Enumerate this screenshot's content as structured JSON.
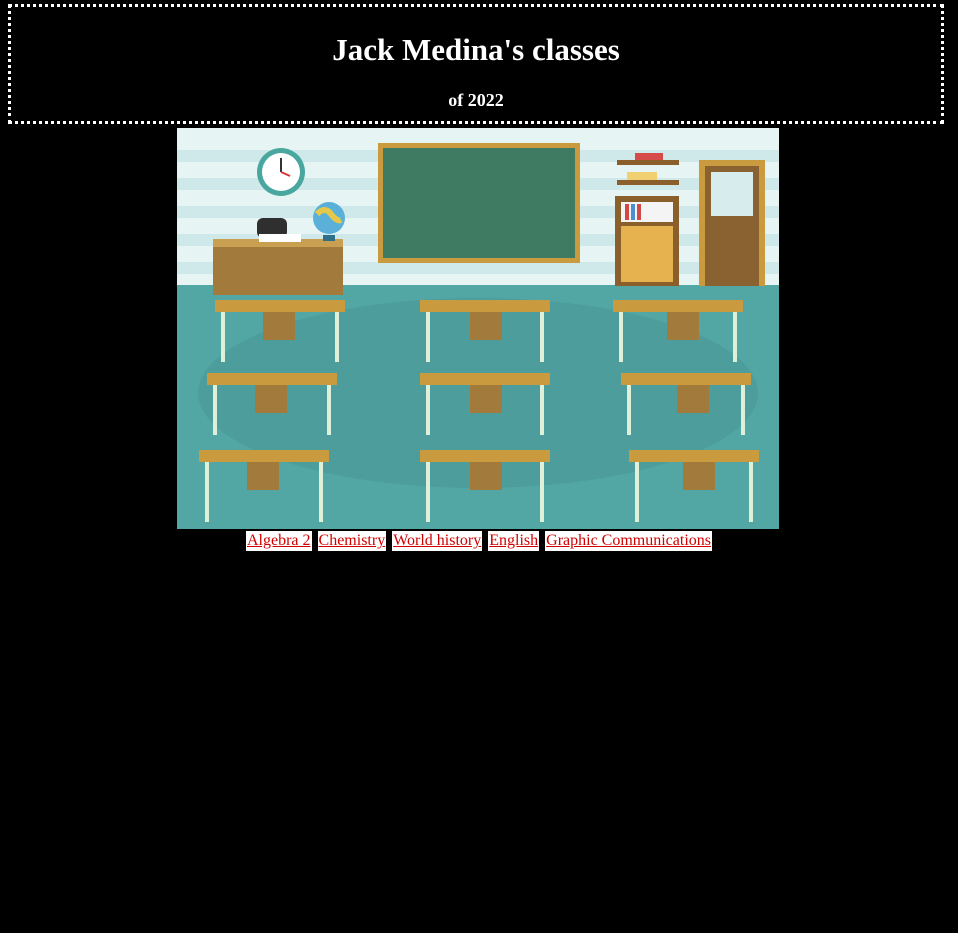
{
  "header": {
    "title": "Jack Medina's classes",
    "subtitle": "of 2022"
  },
  "hero": {
    "alt": "classroom illustration"
  },
  "nav": {
    "links": [
      "Algebra 2",
      "Chemistry",
      "World history",
      "English",
      "Graphic Communications"
    ]
  },
  "colors": {
    "background": "#000000",
    "link": "#d00000",
    "link_bg": "#ffffff"
  }
}
